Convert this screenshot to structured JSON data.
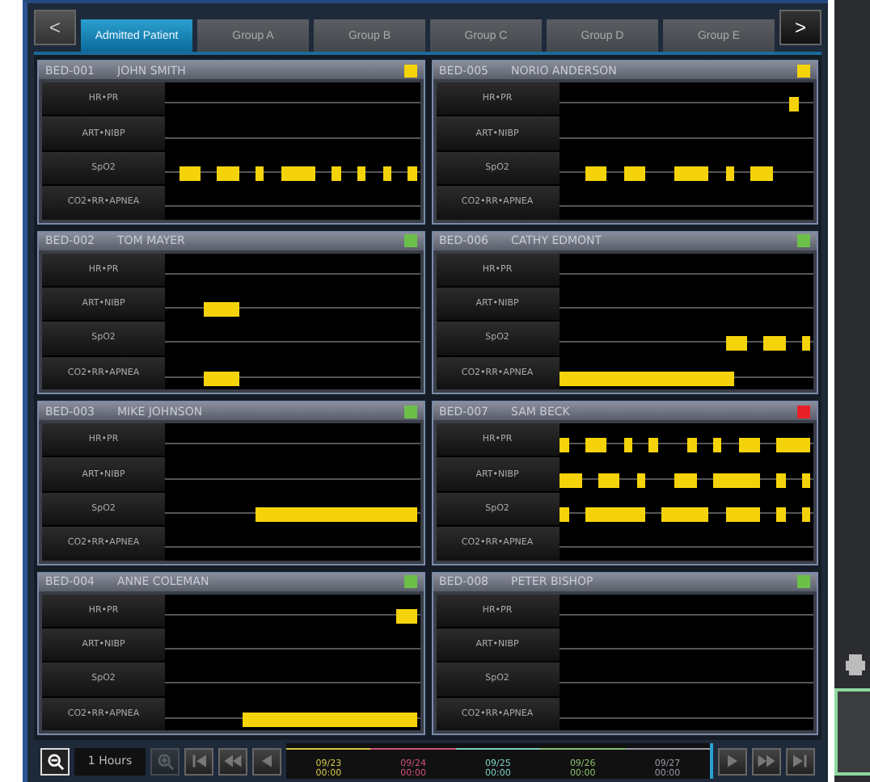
{
  "nav": {
    "prev": "<",
    "next": ">"
  },
  "tabs": [
    {
      "label": "Admitted Patient",
      "selected": true
    },
    {
      "label": "Group A",
      "selected": false
    },
    {
      "label": "Group B",
      "selected": false
    },
    {
      "label": "Group C",
      "selected": false
    },
    {
      "label": "Group D",
      "selected": false
    },
    {
      "label": "Group E",
      "selected": false
    }
  ],
  "panels": [
    {
      "bed": "BED-001",
      "name": "JOHN SMITH",
      "color": "#f5d30a",
      "rows": [
        {
          "label": "HR•PR"
        },
        {
          "label": "ART•NIBP"
        },
        {
          "label": "SpO2"
        },
        {
          "label": "CO2•RR•APNEA"
        }
      ]
    },
    {
      "bed": "BED-005",
      "name": "NORIO ANDERSON",
      "color": "#f5d30a",
      "rows": [
        {
          "label": "HR•PR"
        },
        {
          "label": "ART•NIBP"
        },
        {
          "label": "SpO2"
        },
        {
          "label": "CO2•RR•APNEA"
        }
      ]
    },
    {
      "bed": "BED-002",
      "name": "TOM MAYER",
      "color": "#6cc04a",
      "rows": [
        {
          "label": "HR•PR"
        },
        {
          "label": "ART•NIBP"
        },
        {
          "label": "SpO2"
        },
        {
          "label": "CO2•RR•APNEA"
        }
      ]
    },
    {
      "bed": "BED-006",
      "name": "CATHY EDMONT",
      "color": "#6cc04a",
      "rows": [
        {
          "label": "HR•PR"
        },
        {
          "label": "ART•NIBP"
        },
        {
          "label": "SpO2"
        },
        {
          "label": "CO2•RR•APNEA"
        }
      ]
    },
    {
      "bed": "BED-003",
      "name": "MIKE JOHNSON",
      "color": "#6cc04a",
      "rows": [
        {
          "label": "HR•PR"
        },
        {
          "label": "ART•NIBP"
        },
        {
          "label": "SpO2"
        },
        {
          "label": "CO2•RR•APNEA"
        }
      ]
    },
    {
      "bed": "BED-007",
      "name": "SAM BECK",
      "color": "#e8202a",
      "rows": [
        {
          "label": "HR•PR"
        },
        {
          "label": "ART•NIBP"
        },
        {
          "label": "SpO2"
        },
        {
          "label": "CO2•RR•APNEA"
        }
      ]
    },
    {
      "bed": "BED-004",
      "name": "ANNE COLEMAN",
      "color": "#6cc04a",
      "rows": [
        {
          "label": "HR•PR"
        },
        {
          "label": "ART•NIBP"
        },
        {
          "label": "SpO2"
        },
        {
          "label": "CO2•RR•APNEA"
        }
      ]
    },
    {
      "bed": "BED-008",
      "name": "PETER BISHOP",
      "color": "#6cc04a",
      "rows": [
        {
          "label": "HR•PR"
        },
        {
          "label": "ART•NIBP"
        },
        {
          "label": "SpO2"
        },
        {
          "label": "CO2•RR•APNEA"
        }
      ]
    }
  ],
  "toolbar": {
    "range": "1 Hours",
    "zoom_in_disabled": true,
    "timeline": [
      {
        "date": "09/23",
        "time": "00:00",
        "color": "#d8c84a"
      },
      {
        "date": "09/24",
        "time": "00:00",
        "color": "#d0507a"
      },
      {
        "date": "09/25",
        "time": "00:00",
        "color": "#7ad0c0"
      },
      {
        "date": "09/26",
        "time": "00:00",
        "color": "#8ac070"
      },
      {
        "date": "09/27",
        "time": "00:00",
        "color": "#9a9aa8"
      }
    ]
  }
}
